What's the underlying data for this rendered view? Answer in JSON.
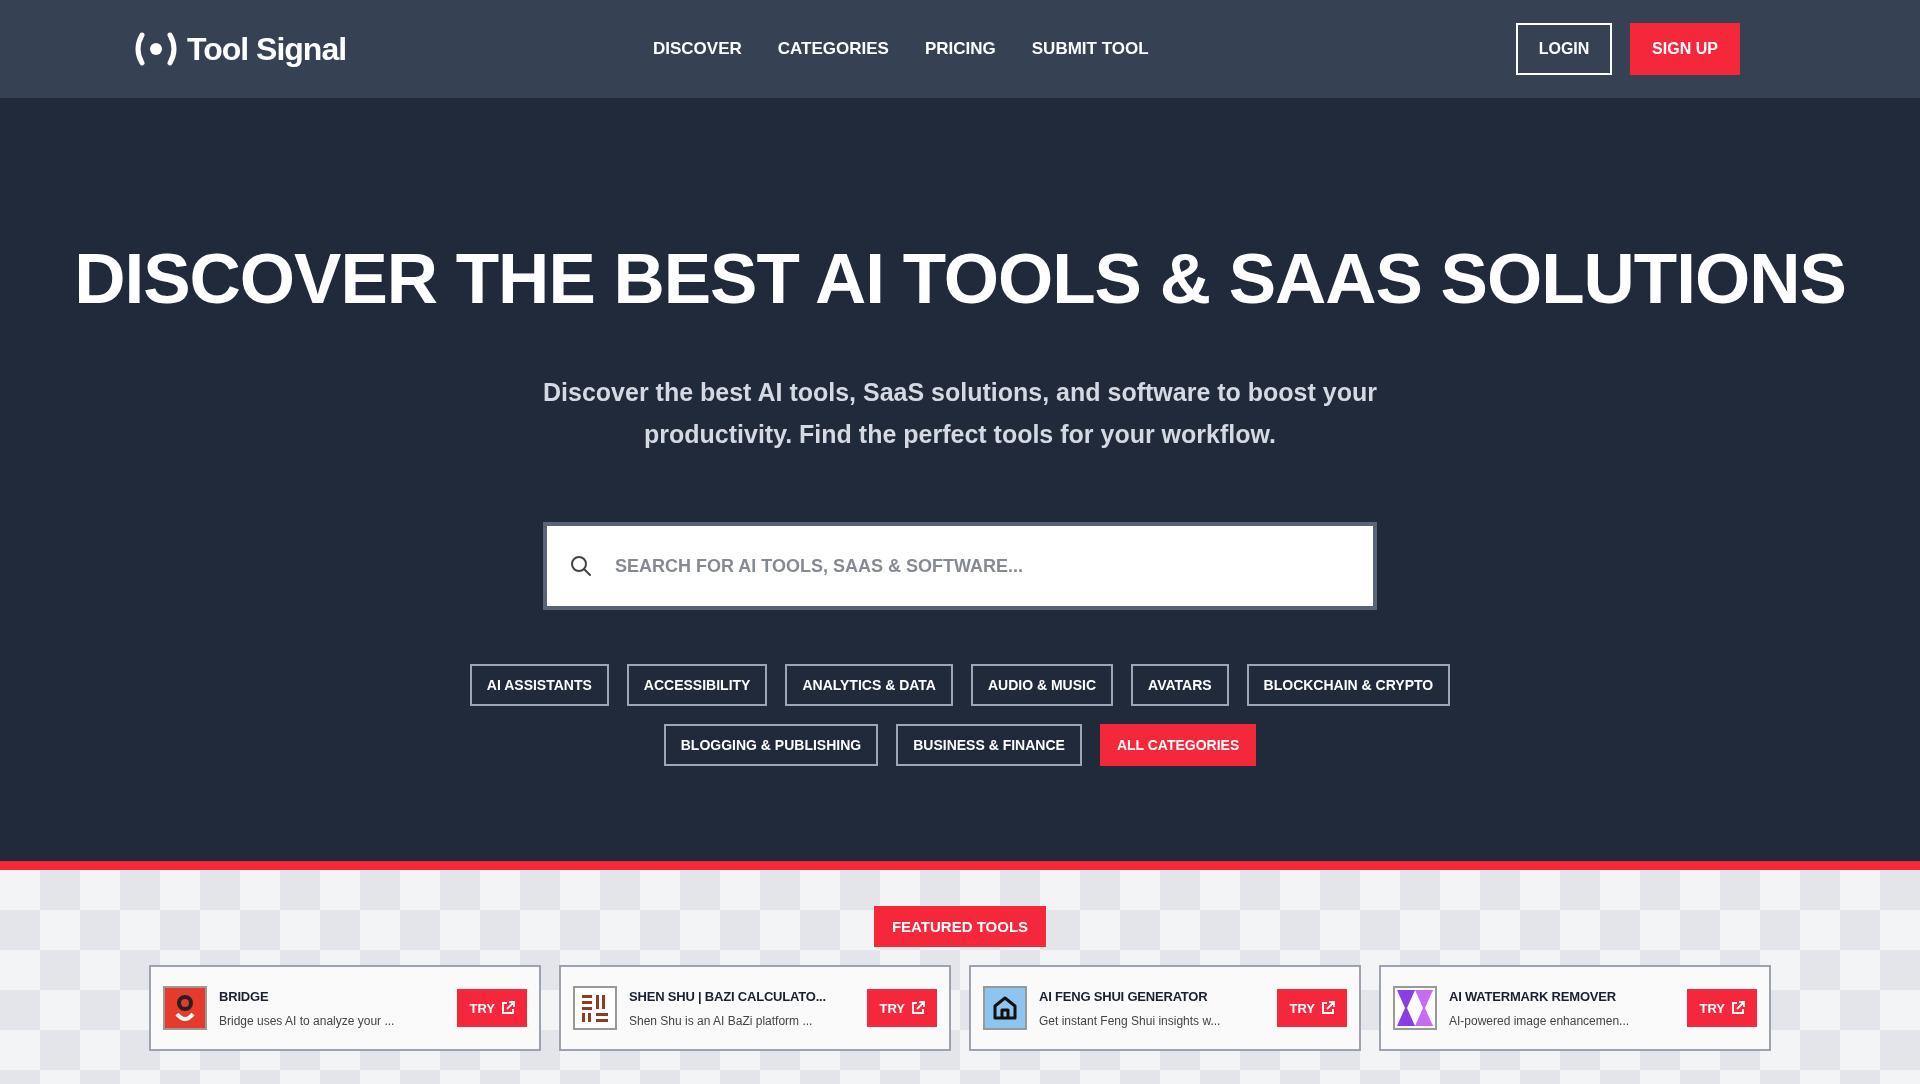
{
  "header": {
    "logo": "Tool Signal",
    "nav": [
      "DISCOVER",
      "CATEGORIES",
      "PRICING",
      "SUBMIT TOOL"
    ],
    "login": "LOGIN",
    "signup": "SIGN UP"
  },
  "hero": {
    "title": "DISCOVER THE BEST AI TOOLS & SAAS SOLUTIONS",
    "subtitle": "Discover the best AI tools, SaaS solutions, and software to boost your productivity. Find the perfect tools for your workflow.",
    "search": {
      "placeholder": "SEARCH FOR AI TOOLS, SAAS & SOFTWARE..."
    },
    "categories": [
      {
        "label": "AI ASSISTANTS",
        "kind": "category"
      },
      {
        "label": "ACCESSIBILITY",
        "kind": "category"
      },
      {
        "label": "ANALYTICS & DATA",
        "kind": "category"
      },
      {
        "label": "AUDIO & MUSIC",
        "kind": "category"
      },
      {
        "label": "AVATARS",
        "kind": "category"
      },
      {
        "label": "BLOCKCHAIN & CRYPTO",
        "kind": "category"
      },
      {
        "label": "BLOGGING & PUBLISHING",
        "kind": "category"
      },
      {
        "label": "BUSINESS & FINANCE",
        "kind": "category"
      },
      {
        "label": "ALL CATEGORIES",
        "kind": "all"
      }
    ]
  },
  "featured": {
    "heading": "FEATURED TOOLS",
    "tools": [
      {
        "name": "BRIDGE",
        "description": "Bridge uses AI to analyze your ...",
        "button": "TRY",
        "kind": "bridge"
      },
      {
        "name": "SHEN SHU | BAZI CALCULATO...",
        "description": "Shen Shu is an AI BaZi platform ...",
        "button": "TRY",
        "kind": "grid"
      },
      {
        "name": "AI FENG SHUI GENERATOR",
        "description": "Get instant Feng Shui insights w...",
        "button": "TRY",
        "kind": "house"
      },
      {
        "name": "AI WATERMARK REMOVER",
        "description": "AI-powered image enhancemen...",
        "button": "TRY",
        "kind": "arrows"
      }
    ]
  }
}
